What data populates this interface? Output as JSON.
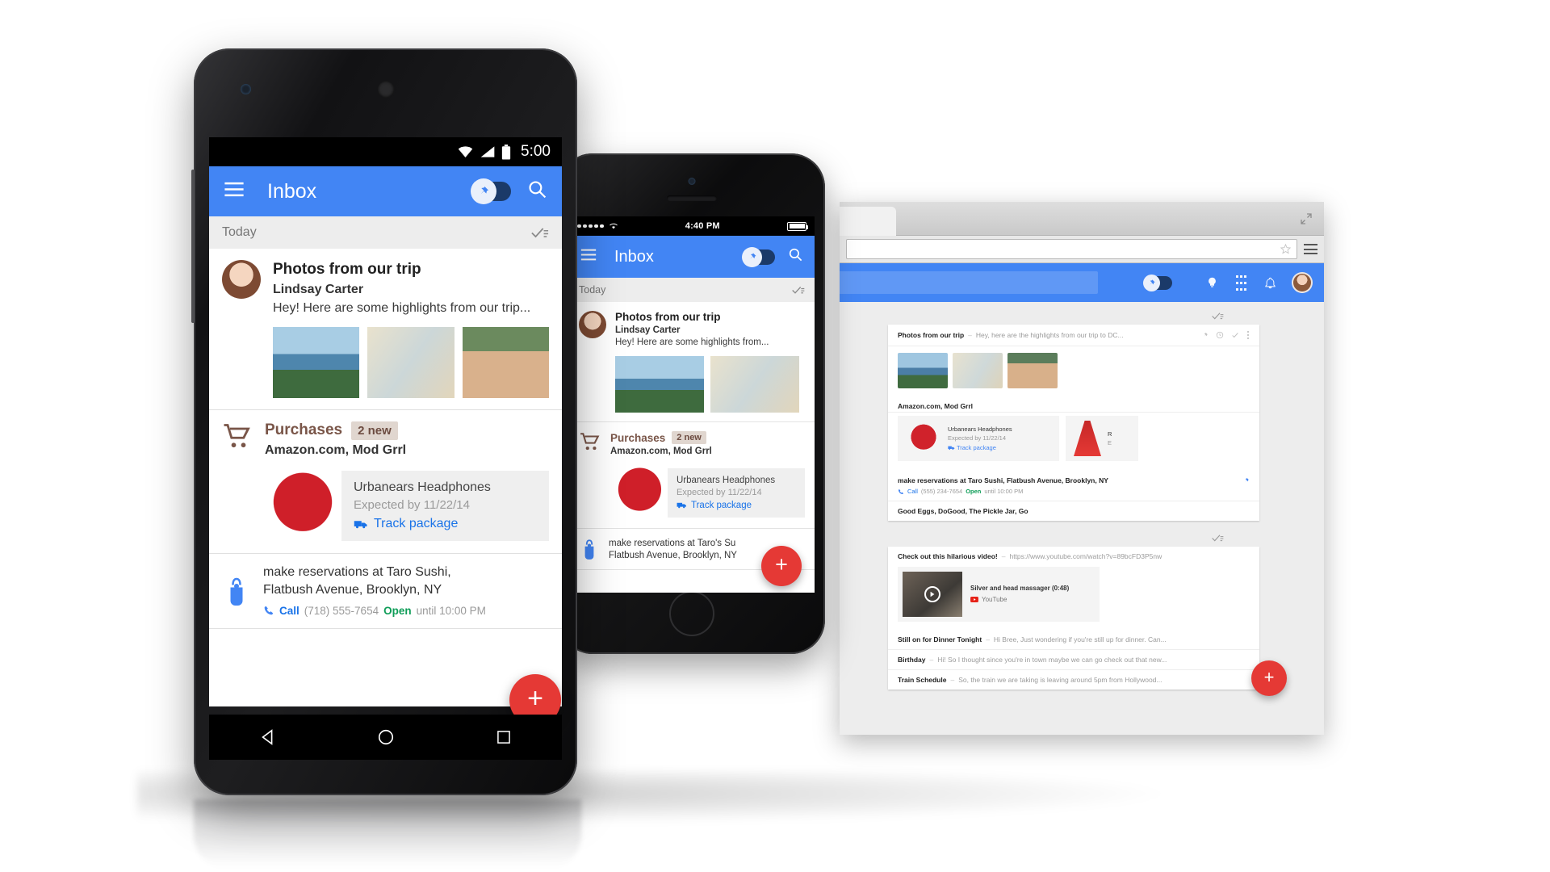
{
  "accent": {
    "blue": "#4285f4",
    "red": "#e53935",
    "brown": "#795548",
    "green": "#0f9d58",
    "link": "#1a73e8"
  },
  "nexus": {
    "device": "Nexus 5",
    "status_bar": {
      "time": "5:00",
      "wifi_icon": "wifi-icon",
      "signal_icon": "signal-icon",
      "battery_icon": "battery-icon"
    },
    "app_bar": {
      "menu_icon": "hamburger-menu-icon",
      "title": "Inbox",
      "pin_toggle": "pin-toggle",
      "search_icon": "search-icon"
    },
    "section": {
      "label": "Today",
      "sweep_icon": "sweep-done-icon"
    },
    "cards": [
      {
        "type": "email",
        "avatar": "avatar-lindsay-carter",
        "subject": "Photos from our trip",
        "sender": "Lindsay Carter",
        "snippet": "Hey! Here are some highlights from our trip...",
        "attachments": [
          "photo-washington-monument",
          "photo-table-setting",
          "photo-friend-portrait"
        ]
      },
      {
        "type": "bundle",
        "icon": "shopping-cart-icon",
        "title": "Purchases",
        "badge": "2 new",
        "senders": "Amazon.com, Mod Grrl",
        "item": {
          "image": "red-headphones-photo",
          "name": "Urbanears Headphones",
          "expected": "Expected by 11/22/14",
          "action_icon": "delivery-truck-icon",
          "action": "Track package"
        }
      },
      {
        "type": "reminder",
        "icon": "finger-string-reminder-icon",
        "text_line1": "make reservations at Taro Sushi,",
        "text_line2": "Flatbush Avenue, Brooklyn, NY",
        "phone_icon": "phone-icon",
        "call_label": "Call",
        "phone": "(718) 555-7654",
        "open_label": "Open",
        "hours": "until 10:00 PM"
      }
    ],
    "fab": {
      "icon": "plus-icon",
      "label": "+"
    },
    "nav_bar": {
      "back": "back-triangle-icon",
      "home": "home-circle-icon",
      "recents": "recents-square-icon"
    }
  },
  "iphone": {
    "device": "iPhone 5",
    "status_bar": {
      "signal_icon": "signal-dots-icon",
      "wifi_icon": "wifi-icon",
      "time": "4:40 PM",
      "battery_icon": "battery-icon"
    },
    "app_bar": {
      "menu_icon": "hamburger-menu-icon",
      "title": "Inbox",
      "pin_toggle": "pin-toggle",
      "search_icon": "search-icon"
    },
    "section": {
      "label": "Today",
      "sweep_icon": "sweep-done-icon"
    },
    "cards": [
      {
        "type": "email",
        "avatar": "avatar-lindsay-carter",
        "subject": "Photos from our trip",
        "sender": "Lindsay Carter",
        "snippet": "Hey! Here are some highlights from...",
        "attachments": [
          "photo-washington-monument",
          "photo-table-setting"
        ]
      },
      {
        "type": "bundle",
        "icon": "shopping-cart-icon",
        "title": "Purchases",
        "badge": "2 new",
        "senders": "Amazon.com, Mod Grrl",
        "item": {
          "image": "red-headphones-photo",
          "name": "Urbanears Headphones",
          "expected": "Expected by 11/22/14",
          "action_icon": "delivery-truck-icon",
          "action": "Track package"
        }
      },
      {
        "type": "reminder",
        "icon": "finger-string-reminder-icon",
        "text_line1": "make reservations at Taro's Su",
        "text_line2": "Flatbush Avenue, Brooklyn, NY"
      }
    ],
    "fab": {
      "icon": "plus-icon",
      "label": "+"
    }
  },
  "desktop": {
    "browser": {
      "expand_icon": "expand-window-icon",
      "url_value": "",
      "url_placeholder": "",
      "star_icon": "bookmark-star-icon",
      "menu_icon": "browser-menu-icon"
    },
    "app_bar": {
      "search_placeholder": "",
      "pin_toggle": "pin-toggle",
      "hint_icon": "lightbulb-icon",
      "apps_icon": "apps-grid-icon",
      "bell_icon": "notifications-bell-icon",
      "avatar": "avatar-account"
    },
    "sweep_icon": "sweep-done-icon",
    "groups": [
      {
        "rows": [
          {
            "subject": "Photos from our trip",
            "separator": "–",
            "snippet": "Hey, here are the highlights from our trip to DC...",
            "actions": [
              "pin-icon",
              "snooze-clock-icon",
              "done-check-icon",
              "overflow-menu-icon"
            ],
            "thumbs": [
              "photo-washington-monument",
              "photo-table-setting",
              "photo-friend-portrait"
            ]
          },
          {
            "subject": "Amazon.com, Mod Grrl",
            "separator": "",
            "snippet": "",
            "purchases": [
              {
                "image": "red-headphones-photo",
                "name": "Urbanears Headphones",
                "expected": "Expected by 11/22/14",
                "action": "Track package"
              },
              {
                "image": "red-dress-photo",
                "name": "R",
                "expected": "E",
                "action": ""
              }
            ]
          },
          {
            "subject": "make reservations at Taro Sushi, Flatbush Avenue, Brooklyn, NY",
            "separator": "",
            "snippet": "",
            "pin": "pin-icon",
            "call_icon": "phone-icon",
            "call_label": "Call",
            "phone": "(555) 234-7654",
            "open_label": "Open",
            "hours": "until 10:00 PM"
          },
          {
            "subject": "Good Eggs, DoGood, The Pickle Jar, Go",
            "separator": "",
            "snippet": ""
          }
        ]
      },
      {
        "rows": [
          {
            "subject": "Check out this hilarious video!",
            "separator": "–",
            "snippet": "https://www.youtube.com/watch?v=89bcFD3P5nw",
            "video": {
              "thumb": "video-thumbnail",
              "play_icon": "play-button-icon",
              "title": "Silver and head massager (0:48)",
              "source_icon": "youtube-icon",
              "source": "YouTube"
            }
          },
          {
            "subject": "Still on for Dinner Tonight",
            "separator": "–",
            "snippet": "Hi Bree, Just wondering if you're still up for dinner. Can..."
          },
          {
            "subject": "Birthday",
            "separator": "–",
            "snippet": "Hi! So I thought since you're in town maybe we can go check out that new..."
          },
          {
            "subject": "Train Schedule",
            "separator": "–",
            "snippet": "So, the train we are taking is leaving around 5pm from Hollywood..."
          }
        ]
      }
    ],
    "fab": {
      "icon": "plus-icon",
      "label": "+"
    }
  }
}
